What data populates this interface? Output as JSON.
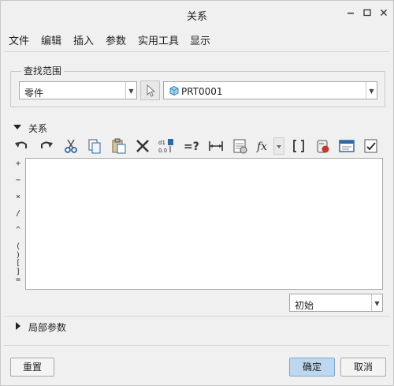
{
  "window": {
    "title": "关系"
  },
  "menu": {
    "items": [
      "文件",
      "编辑",
      "插入",
      "参数",
      "实用工具",
      "显示"
    ]
  },
  "scope": {
    "group_label": "查找范围",
    "type_value": "零件",
    "part_value": "PRT0001"
  },
  "relations": {
    "section_label": "关系",
    "operators": [
      "+",
      "−",
      "×",
      "/",
      "^",
      "( )",
      "[ ]",
      "="
    ],
    "initial_value": "初始"
  },
  "local_params": {
    "section_label": "局部参数"
  },
  "buttons": {
    "reset": "重置",
    "ok": "确定",
    "cancel": "取消"
  },
  "colors": {
    "accent": "#bcd7ee",
    "icon_blue": "#2d6aa6",
    "icon_red": "#c0392b"
  }
}
